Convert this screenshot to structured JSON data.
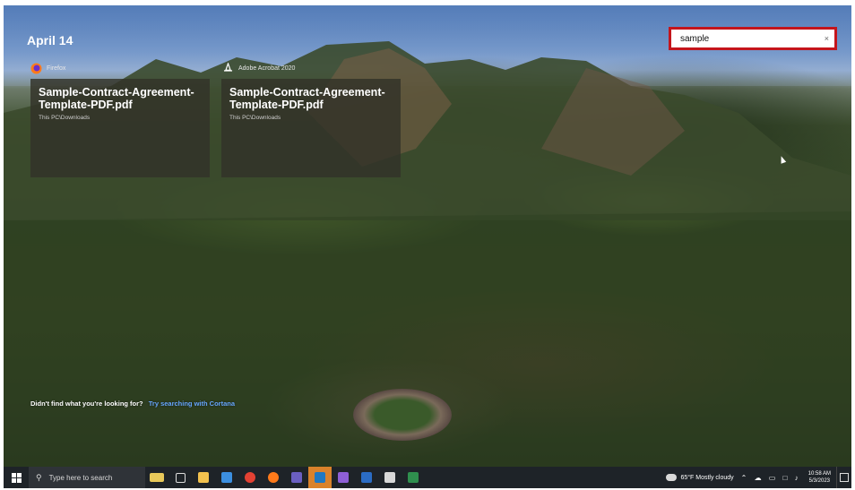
{
  "wallpaper": {
    "scene": "mountain-town-aerial"
  },
  "date_heading": "April 14",
  "search": {
    "value": "sample",
    "clear_glyph": "×"
  },
  "results": [
    {
      "app_name": "Firefox",
      "app_icon": "firefox-icon",
      "title": "Sample-Contract-Agreement-Template-PDF.pdf",
      "path": "This PC\\Downloads"
    },
    {
      "app_name": "Adobe Acrobat 2020",
      "app_icon": "acrobat-icon",
      "title": "Sample-Contract-Agreement-Template-PDF.pdf",
      "path": "This PC\\Downloads"
    }
  ],
  "cortana": {
    "prompt": "Didn't find what you're looking for?",
    "link": "Try searching with Cortana"
  },
  "taskbar": {
    "search_placeholder": "Type here to search",
    "weather": "65°F  Mostly cloudy",
    "time": "10:58 AM",
    "date": "5/3/2023",
    "pinned_icons": [
      "news-widget-icon",
      "task-view-icon",
      "file-explorer-icon",
      "store-icon",
      "chrome-icon",
      "firefox-icon",
      "teams-icon",
      "outlook-icon",
      "visual-studio-icon",
      "word-icon",
      "paint-icon",
      "excel-icon"
    ],
    "colors": {
      "bar": "#1e2328",
      "active": "#d9822b"
    }
  },
  "accent_colors": {
    "highlight_border": "#c4151c",
    "link": "#68a8ff"
  }
}
